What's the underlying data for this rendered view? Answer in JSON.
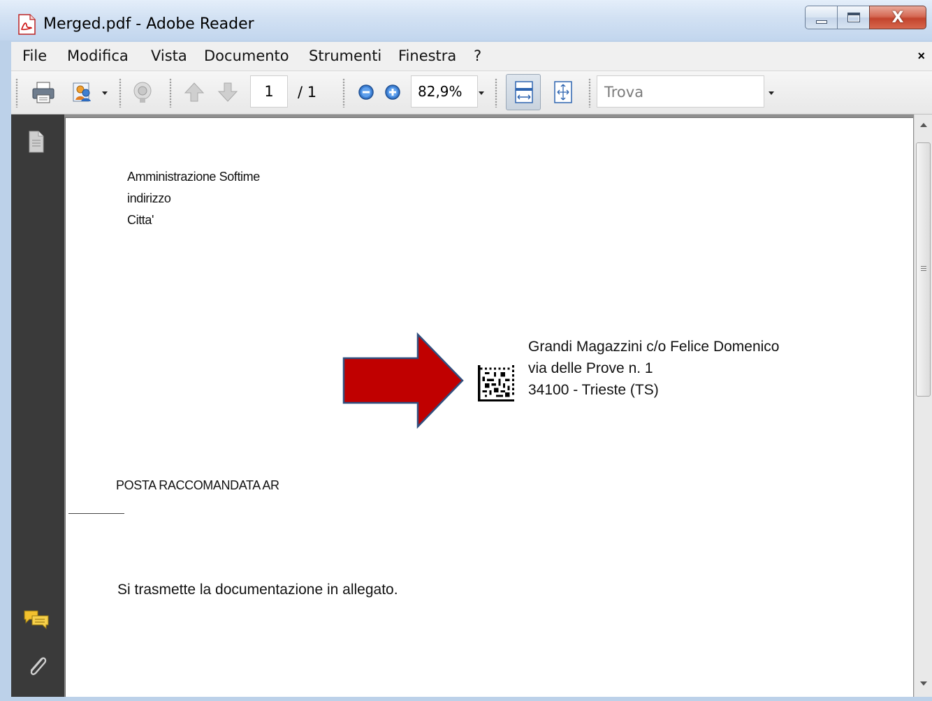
{
  "window": {
    "title": "Merged.pdf - Adobe Reader",
    "close_glyph": "X"
  },
  "menu": {
    "items": [
      "File",
      "Modifica",
      "Vista",
      "Documento",
      "Strumenti",
      "Finestra",
      "?"
    ],
    "close_glyph": "×"
  },
  "toolbar": {
    "current_page": "1",
    "total_pages": "/ 1",
    "zoom": "82,9%",
    "find_placeholder": "Trova",
    "icons": [
      "print-icon",
      "share-icon",
      "collaborate-icon",
      "previous-page-icon",
      "next-page-icon",
      "zoom-out-icon",
      "zoom-in-icon",
      "fit-width-icon",
      "fit-page-icon"
    ]
  },
  "navpanel": {
    "icons": [
      "pages-icon",
      "comments-icon",
      "attachments-icon"
    ]
  },
  "document": {
    "sender": [
      "Amministrazione Softime",
      "indirizzo",
      "Citta'"
    ],
    "recipient": [
      "Grandi Magazzini c/o Felice Domenico",
      "via  delle Prove n. 1",
      "34100 -  Trieste (TS)"
    ],
    "mail_type": "POSTA RACCOMANDATA AR",
    "body": "Si trasmette la documentazione in allegato."
  },
  "colors": {
    "arrow_fill": "#c00000",
    "arrow_stroke": "#2f4f7f",
    "nav_panel": "#3a3a3a"
  }
}
